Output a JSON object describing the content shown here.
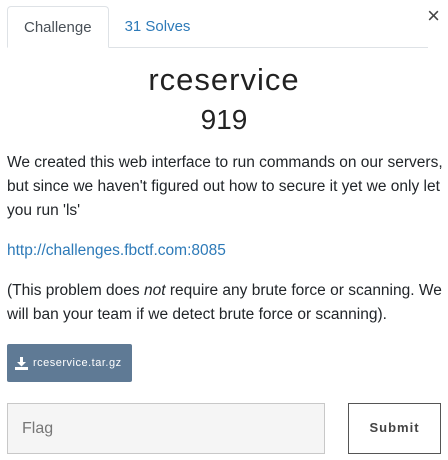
{
  "modal": {
    "close_symbol": "×"
  },
  "tabs": [
    {
      "label": "Challenge",
      "active": true
    },
    {
      "label": "31 Solves",
      "active": false
    }
  ],
  "challenge": {
    "name": "rceservice",
    "points": "919",
    "description": "We created this web interface to run commands on our servers, but since we haven't figured out how to secure it yet we only let you run 'ls'",
    "url": "http://challenges.fbctf.com:8085",
    "note_before": "(This problem does ",
    "note_emphasis": "not",
    "note_after": " require any brute force or scanning. We will ban your team if we detect brute force or scanning).",
    "file_label": "rceservice.tar.gz"
  },
  "submission": {
    "flag_placeholder": "Flag",
    "submit_label": "Submit"
  },
  "icons": {
    "download": "download-icon",
    "close": "close-icon"
  },
  "colors": {
    "link": "#2d7ab8",
    "file_button": "#5f7a95"
  }
}
